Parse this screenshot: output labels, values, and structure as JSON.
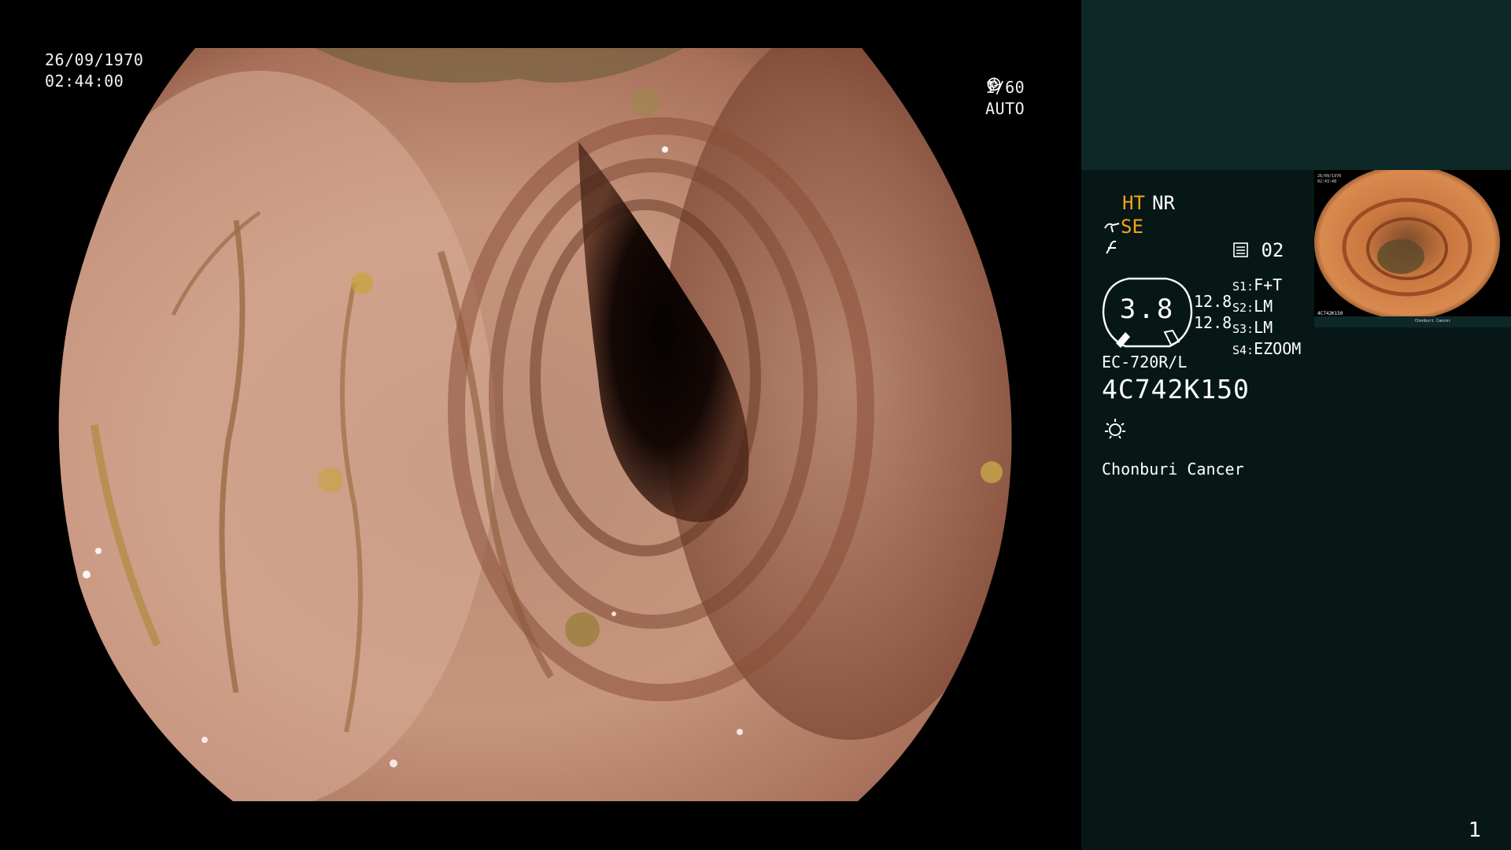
{
  "overlay": {
    "date": "26/09/1970",
    "time": "02:44:00",
    "shutter": "1/60",
    "iris": "AUTO",
    "shutter_icon": "shutter-icon",
    "iris_icon": "iris-icon"
  },
  "panel": {
    "mode_ht": "HT",
    "mode_nr": "NR",
    "se_label": "SE",
    "memo_value": "02",
    "gauge_value": "3.8",
    "sub_value_1": "12.8",
    "sub_value_2": "12.8",
    "switches": [
      {
        "key": "S1:",
        "value": "F+T"
      },
      {
        "key": "S2:",
        "value": "LM"
      },
      {
        "key": "S3:",
        "value": "LM"
      },
      {
        "key": "S4:",
        "value": "EZOOM"
      }
    ],
    "scope_model": "EC-720R/L",
    "scope_serial": "4C742K150",
    "hospital": "Chonburi Cancer",
    "page_number": "1"
  },
  "thumbnail": {
    "date": "26/09/1970",
    "time": "02:43:48",
    "serial": "4C742K150",
    "hospital": "Chonburi Cancer"
  },
  "colors": {
    "accent_orange": "#f5a21a",
    "panel_bg": "#061716",
    "panel_top_bg": "#0e2727"
  }
}
